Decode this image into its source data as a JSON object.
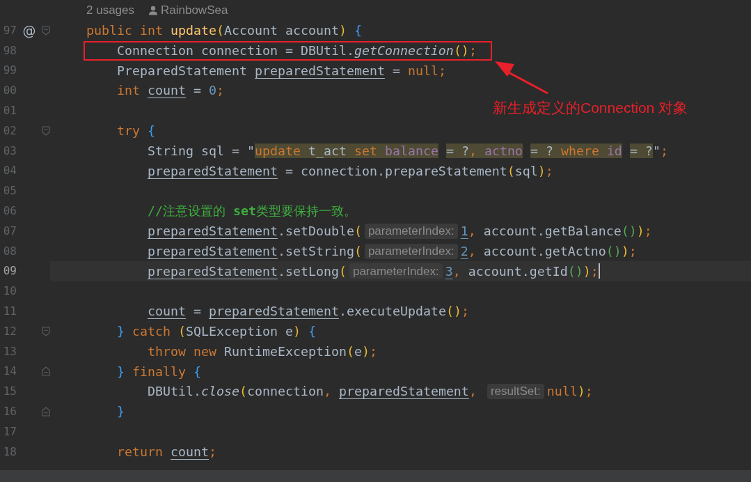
{
  "editor": {
    "inlay": {
      "usages": "2 usages",
      "author": "RainbowSea"
    },
    "lines": [
      {
        "number": "97",
        "marker": "@",
        "fold": {
          "kind": "start"
        },
        "current": false,
        "boxed": false,
        "segments": [
          {
            "kind": "code",
            "tokens": [
              {
                "text": "public int ",
                "kind": "kw"
              },
              {
                "text": "update",
                "kind": "fn"
              },
              {
                "text": "(",
                "kind": "p1"
              },
              {
                "text": "Account account",
                "kind": "id"
              },
              {
                "text": ") ",
                "kind": "p1"
              },
              {
                "text": "{",
                "kind": "p3"
              }
            ]
          }
        ]
      },
      {
        "number": "98",
        "current": false,
        "boxed": true,
        "segments": [
          {
            "kind": "code",
            "tokens": [
              {
                "text": "    Connection connection = DBUtil.",
                "kind": "id"
              },
              {
                "text": "getConnection",
                "kind": "it"
              },
              {
                "text": "()",
                "kind": "p1"
              },
              {
                "text": ";",
                "kind": "kw"
              }
            ]
          }
        ]
      },
      {
        "number": "99",
        "current": false,
        "boxed": false,
        "segments": [
          {
            "kind": "code",
            "tokens": [
              {
                "text": "    PreparedStatement ",
                "kind": "id"
              },
              {
                "text": "preparedStatement",
                "kind": "var"
              },
              {
                "text": " = ",
                "kind": "id"
              },
              {
                "text": "null;",
                "kind": "kw"
              }
            ]
          }
        ]
      },
      {
        "number": "00",
        "current": false,
        "boxed": false,
        "segments": [
          {
            "kind": "code",
            "tokens": [
              {
                "text": "    int ",
                "kind": "kw"
              },
              {
                "text": "count",
                "kind": "var"
              },
              {
                "text": " = ",
                "kind": "id"
              },
              {
                "text": "0",
                "kind": "num"
              },
              {
                "text": ";",
                "kind": "kw"
              }
            ]
          }
        ]
      },
      {
        "number": "01",
        "current": false,
        "boxed": false
      },
      {
        "number": "02",
        "fold": {
          "kind": "start"
        },
        "current": false,
        "boxed": false,
        "segments": [
          {
            "kind": "code",
            "tokens": [
              {
                "text": "    try ",
                "kind": "kw"
              },
              {
                "text": "{",
                "kind": "p3"
              }
            ]
          }
        ]
      },
      {
        "number": "03",
        "current": false,
        "boxed": false,
        "segments": [
          {
            "kind": "code",
            "tokens": [
              {
                "text": "        String sql = \"",
                "kind": "id"
              },
              {
                "text": "update ",
                "kind": "sqlk"
              },
              {
                "text": "t_act ",
                "kind": "sql"
              },
              {
                "text": "set ",
                "kind": "sqlk"
              },
              {
                "text": "balance",
                "kind": "sqlc"
              },
              {
                "text": " = ?",
                "kind": "sql"
              },
              {
                "text": ", ",
                "kind": "sqlk"
              },
              {
                "text": "actno",
                "kind": "sqlc"
              },
              {
                "text": " = ? ",
                "kind": "sql"
              },
              {
                "text": "where ",
                "kind": "sqlk"
              },
              {
                "text": "id",
                "kind": "sqlc"
              },
              {
                "text": " = ?",
                "kind": "sql"
              },
              {
                "text": "\"",
                "kind": "id"
              },
              {
                "text": ";",
                "kind": "kw"
              }
            ]
          }
        ]
      },
      {
        "number": "04",
        "current": false,
        "boxed": false,
        "segments": [
          {
            "kind": "code",
            "tokens": [
              {
                "text": "        preparedStatement",
                "kind": "var"
              },
              {
                "text": " = connection.prepareStatement",
                "kind": "id"
              },
              {
                "text": "(",
                "kind": "p1"
              },
              {
                "text": "sql",
                "kind": "id"
              },
              {
                "text": ")",
                "kind": "p1"
              },
              {
                "text": ";",
                "kind": "kw"
              }
            ]
          }
        ]
      },
      {
        "number": "05",
        "current": false,
        "boxed": false
      },
      {
        "number": "06",
        "current": false,
        "boxed": false,
        "segments": [
          {
            "kind": "code",
            "tokens": [
              {
                "text": "        //注意设置的 ",
                "kind": "cmt"
              },
              {
                "text": "set",
                "kind": "cmtb"
              },
              {
                "text": "类型要保持一致。",
                "kind": "cmt"
              }
            ]
          }
        ]
      },
      {
        "number": "07",
        "current": false,
        "boxed": false,
        "segments": [
          {
            "kind": "code",
            "tokens": [
              {
                "text": "        preparedStatement",
                "kind": "var"
              },
              {
                "text": ".setDouble",
                "kind": "id"
              },
              {
                "text": "(",
                "kind": "p1"
              }
            ]
          },
          {
            "kind": "hint",
            "text": "parameterIndex:"
          },
          {
            "kind": "code",
            "tokens": [
              {
                "text": "1",
                "kind": "numu"
              },
              {
                "text": ", ",
                "kind": "kw"
              },
              {
                "text": "account.getBalance",
                "kind": "id"
              },
              {
                "text": "()",
                "kind": "p2"
              },
              {
                "text": ")",
                "kind": "p1"
              },
              {
                "text": ";",
                "kind": "kw"
              }
            ]
          }
        ]
      },
      {
        "number": "08",
        "current": false,
        "boxed": false,
        "segments": [
          {
            "kind": "code",
            "tokens": [
              {
                "text": "        preparedStatement",
                "kind": "var"
              },
              {
                "text": ".setString",
                "kind": "id"
              },
              {
                "text": "(",
                "kind": "p1"
              }
            ]
          },
          {
            "kind": "hint",
            "text": "parameterIndex:"
          },
          {
            "kind": "code",
            "tokens": [
              {
                "text": "2",
                "kind": "numu"
              },
              {
                "text": ", ",
                "kind": "kw"
              },
              {
                "text": "account.getActno",
                "kind": "id"
              },
              {
                "text": "()",
                "kind": "p2"
              },
              {
                "text": ")",
                "kind": "p1"
              },
              {
                "text": ";",
                "kind": "kw"
              }
            ]
          }
        ]
      },
      {
        "number": "09",
        "current": true,
        "boxed": false,
        "segments": [
          {
            "kind": "code",
            "tokens": [
              {
                "text": "        preparedStatement",
                "kind": "var"
              },
              {
                "text": ".setLong",
                "kind": "id"
              },
              {
                "text": "(",
                "kind": "p1"
              }
            ]
          },
          {
            "kind": "hint",
            "text": "parameterIndex:"
          },
          {
            "kind": "code",
            "tokens": [
              {
                "text": "3",
                "kind": "numu"
              },
              {
                "text": ", ",
                "kind": "kw"
              },
              {
                "text": "account.getId",
                "kind": "id"
              },
              {
                "text": "()",
                "kind": "p2"
              },
              {
                "text": ")",
                "kind": "p1"
              },
              {
                "text": ";",
                "kind": "kw"
              }
            ]
          }
        ]
      },
      {
        "number": "10",
        "current": false,
        "boxed": false
      },
      {
        "number": "11",
        "current": false,
        "boxed": false,
        "segments": [
          {
            "kind": "code",
            "tokens": [
              {
                "text": "        count",
                "kind": "var"
              },
              {
                "text": " = ",
                "kind": "id"
              },
              {
                "text": "preparedStatement",
                "kind": "var"
              },
              {
                "text": ".executeUpdate",
                "kind": "id"
              },
              {
                "text": "()",
                "kind": "p1"
              },
              {
                "text": ";",
                "kind": "kw"
              }
            ]
          }
        ]
      },
      {
        "number": "12",
        "fold": {
          "kind": "start"
        },
        "current": false,
        "boxed": false,
        "segments": [
          {
            "kind": "code",
            "tokens": [
              {
                "text": "    }",
                "kind": "p3"
              },
              {
                "text": " catch ",
                "kind": "kw"
              },
              {
                "text": "(",
                "kind": "p1"
              },
              {
                "text": "SQLException e",
                "kind": "id"
              },
              {
                "text": ") ",
                "kind": "p1"
              },
              {
                "text": "{",
                "kind": "p3"
              }
            ]
          }
        ]
      },
      {
        "number": "13",
        "current": false,
        "boxed": false,
        "segments": [
          {
            "kind": "code",
            "tokens": [
              {
                "text": "        throw new ",
                "kind": "kw"
              },
              {
                "text": "RuntimeException",
                "kind": "id"
              },
              {
                "text": "(",
                "kind": "p1"
              },
              {
                "text": "e",
                "kind": "id"
              },
              {
                "text": ")",
                "kind": "p1"
              },
              {
                "text": ";",
                "kind": "kw"
              }
            ]
          }
        ]
      },
      {
        "number": "14",
        "fold": {
          "kind": "end"
        },
        "current": false,
        "boxed": false,
        "segments": [
          {
            "kind": "code",
            "tokens": [
              {
                "text": "    }",
                "kind": "p3"
              },
              {
                "text": " finally ",
                "kind": "kw"
              },
              {
                "text": "{",
                "kind": "p3"
              }
            ]
          }
        ]
      },
      {
        "number": "15",
        "current": false,
        "boxed": false,
        "segments": [
          {
            "kind": "code",
            "tokens": [
              {
                "text": "        DBUtil.",
                "kind": "id"
              },
              {
                "text": "close",
                "kind": "it"
              },
              {
                "text": "(",
                "kind": "p1"
              },
              {
                "text": "connection",
                "kind": "id"
              },
              {
                "text": ", ",
                "kind": "kw"
              },
              {
                "text": "preparedStatement",
                "kind": "var"
              },
              {
                "text": ", ",
                "kind": "kw"
              }
            ]
          },
          {
            "kind": "hint",
            "text": "resultSet:"
          },
          {
            "kind": "code",
            "tokens": [
              {
                "text": "null",
                "kind": "kw"
              },
              {
                "text": ")",
                "kind": "p1"
              },
              {
                "text": ";",
                "kind": "kw"
              }
            ]
          }
        ]
      },
      {
        "number": "16",
        "fold": {
          "kind": "end"
        },
        "current": false,
        "boxed": false,
        "segments": [
          {
            "kind": "code",
            "tokens": [
              {
                "text": "    }",
                "kind": "p3"
              }
            ]
          }
        ]
      },
      {
        "number": "17",
        "current": false,
        "boxed": false
      },
      {
        "number": "18",
        "current": false,
        "boxed": false,
        "segments": [
          {
            "kind": "code",
            "tokens": [
              {
                "text": "    return ",
                "kind": "kw"
              },
              {
                "text": "count",
                "kind": "var"
              },
              {
                "text": ";",
                "kind": "kw"
              }
            ]
          }
        ]
      }
    ]
  },
  "annotation": {
    "text": "新生成定义的Connection 对象"
  }
}
